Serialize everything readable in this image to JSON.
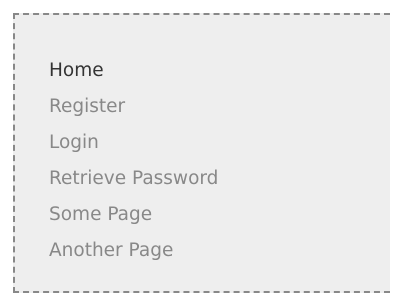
{
  "menu": {
    "items": [
      {
        "label": "Home",
        "active": true
      },
      {
        "label": "Register",
        "active": false
      },
      {
        "label": "Login",
        "active": false
      },
      {
        "label": "Retrieve Password",
        "active": false
      },
      {
        "label": "Some Page",
        "active": false
      },
      {
        "label": "Another Page",
        "active": false
      }
    ]
  },
  "colors": {
    "panel_background": "#eeeeee",
    "dashed_border": "#888888",
    "active_link": "#333333",
    "inactive_link": "#888888"
  }
}
